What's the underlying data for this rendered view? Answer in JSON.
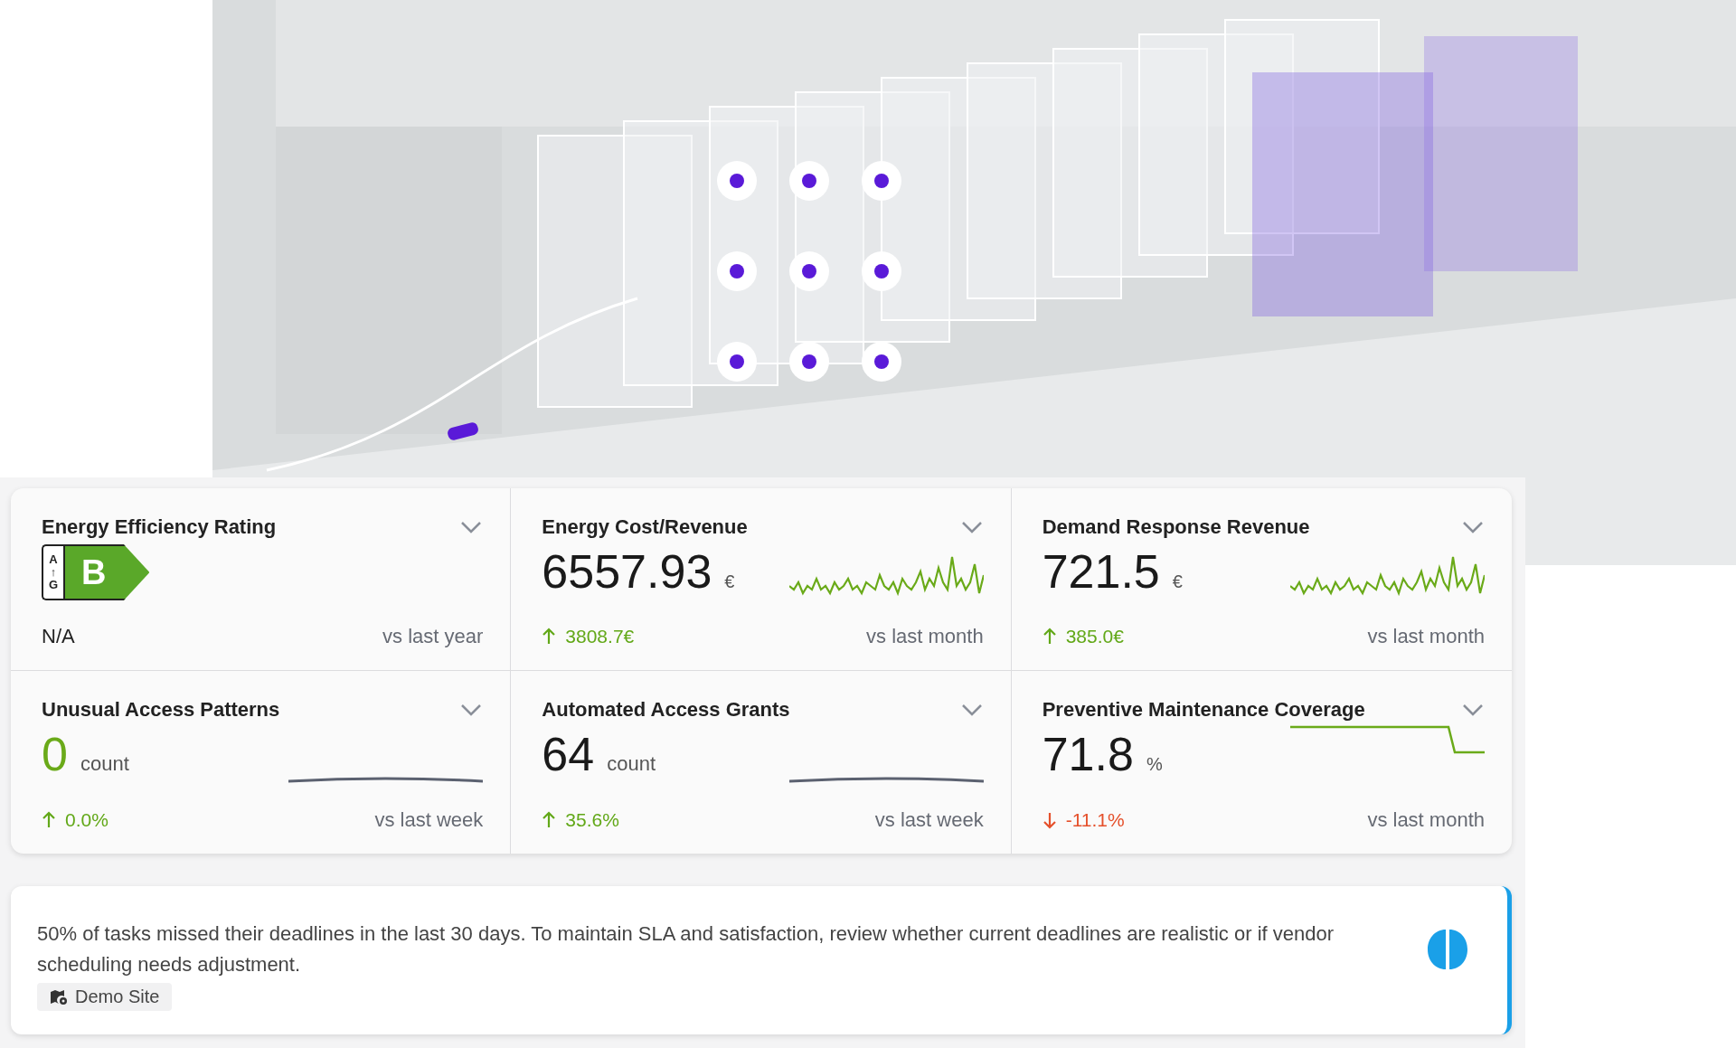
{
  "kpis": [
    {
      "kind": "rating",
      "title": "Energy Efficiency Rating",
      "scale_top": "A",
      "scale_arrow": "↑",
      "scale_bottom": "G",
      "grade": "B",
      "value": "N/A",
      "comparison": "vs last year"
    },
    {
      "kind": "metric",
      "title": "Energy Cost/Revenue",
      "value": "6557.93",
      "unit": "€",
      "highlight": false,
      "increase": true,
      "change": "3808.7€",
      "comparison": "vs last month"
    },
    {
      "kind": "metric",
      "title": "Demand Response Revenue",
      "value": "721.5",
      "unit": "€",
      "highlight": false,
      "increase": true,
      "change": "385.0€",
      "comparison": "vs last month"
    },
    {
      "kind": "metric",
      "title": "Unusual Access Patterns",
      "value": "0",
      "unit": "count",
      "highlight": true,
      "increase": true,
      "change": "0.0%",
      "comparison": "vs last week"
    },
    {
      "kind": "metric",
      "title": "Automated Access Grants",
      "value": "64",
      "unit": "count",
      "highlight": false,
      "increase": true,
      "change": "35.6%",
      "comparison": "vs last week"
    },
    {
      "kind": "metric",
      "title": "Preventive Maintenance Coverage",
      "value": "71.8",
      "unit": "%",
      "highlight": false,
      "increase": false,
      "change": "-11.1%",
      "comparison": "vs last month"
    }
  ],
  "insight": {
    "text": "50% of tasks missed their deadlines in the last 30 days. To maintain SLA and satisfaction, review whether current deadlines are realistic or if vendor scheduling needs adjustment.",
    "site": "Demo Site"
  }
}
